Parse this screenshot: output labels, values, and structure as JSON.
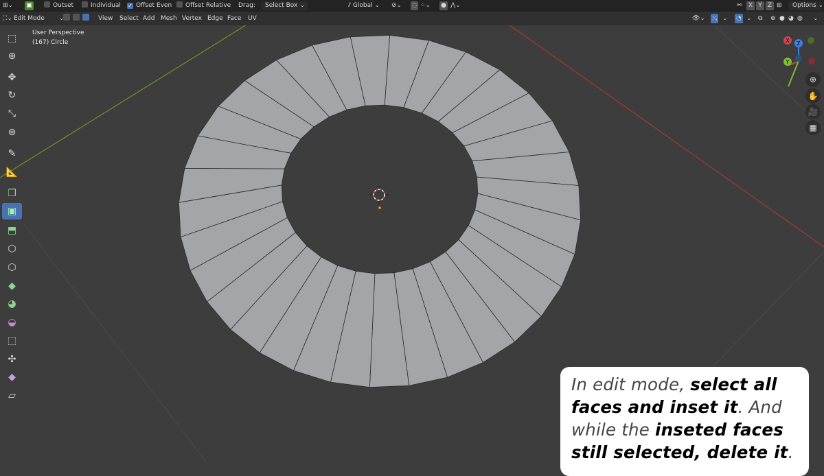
{
  "tool_header": {
    "outset_label": "Outset",
    "individual_label": "Individual",
    "offset_even_label": "Offset Even",
    "offset_relative_label": "Offset Relative",
    "drag_label": "Drag:",
    "drag_value": "Select Box",
    "orientation_value": "Global",
    "axis_x": "X",
    "axis_y": "Y",
    "axis_z": "Z",
    "options_label": "Options",
    "offset_even_checked": true,
    "outset_checked": false,
    "individual_checked": false,
    "offset_relative_checked": false
  },
  "viewport_header": {
    "mode_value": "Edit Mode",
    "menus": [
      "View",
      "Select",
      "Add",
      "Mesh",
      "Vertex",
      "Edge",
      "Face",
      "UV"
    ]
  },
  "overlay": {
    "perspective": "User Perspective",
    "object_info": "(167) Circle"
  },
  "gizmo": {
    "x_label": "X",
    "y_label": "Y",
    "z_label": "Z"
  },
  "toolbar": {
    "tools": [
      "select-box-icon",
      "cursor-icon",
      "move-icon",
      "rotate-icon",
      "scale-icon",
      "transform-icon",
      "annotate-icon",
      "measure-icon",
      "add-cube-icon",
      "extrude-region-icon",
      "inset-faces-icon",
      "bevel-icon",
      "loop-cut-icon",
      "knife-icon",
      "poly-build-icon",
      "spin-icon",
      "smooth-icon",
      "edge-slide-icon",
      "shrink-fatten-icon",
      "shear-icon",
      "rip-region-icon"
    ],
    "active_tool": "extrude-region-icon"
  },
  "caption": {
    "part1": "In edit mode, ",
    "part2": "select all faces and inset it",
    "part3": ". And while the ",
    "part4": "inseted faces still selected, delete it",
    "part5": "."
  },
  "colors": {
    "accent": "#4772b3",
    "background": "#3d3d3d",
    "face_fill": "#a3a5a8",
    "x_axis_line": "#9a3b3b",
    "y_axis_line": "#6a8f2a",
    "gizmo_x": "#d4434f",
    "gizmo_y": "#7cbf2f",
    "gizmo_z": "#3f80e0"
  }
}
